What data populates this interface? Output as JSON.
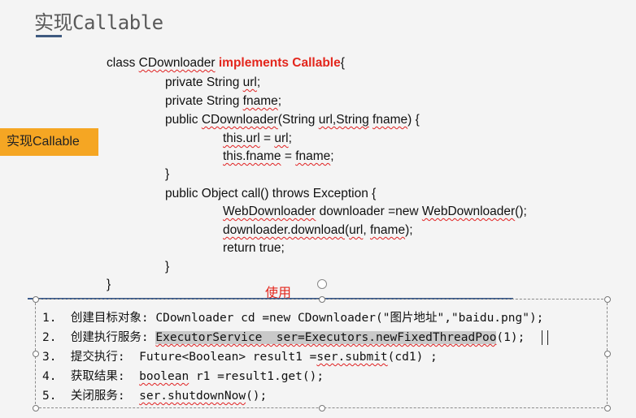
{
  "slide": {
    "title": "实现Callable",
    "tag": "实现Callable",
    "box_label": "使用"
  },
  "code": {
    "l1_a": "class ",
    "l1_b": "CDownloader",
    "l1_c": " implements Callable",
    "l1_d": "{",
    "l2_a": "private String ",
    "l2_b": "url",
    "l2_c": ";",
    "l3_a": "private String ",
    "l3_b": "fname",
    "l3_c": ";",
    "l4_a": "public ",
    "l4_b": "CDownloader",
    "l4_c": "(String ",
    "l4_d": "url,String",
    "l4_e": " ",
    "l4_f": "fname",
    "l4_g": ") {",
    "l5_a": "this.url",
    "l5_b": " = ",
    "l5_c": "url",
    "l5_d": ";",
    "l6_a": "this.fname",
    "l6_b": " = ",
    "l6_c": "fname",
    "l6_d": ";",
    "l7": "}",
    "l8": "public Object call() throws Exception {",
    "l9_a": "WebDownloader",
    "l9_b": " downloader =new ",
    "l9_c": "WebDownloader",
    "l9_d": "();",
    "l10_a": "downloader.download",
    "l10_b": "(",
    "l10_c": "url",
    "l10_d": ", ",
    "l10_e": "fname",
    "l10_f": ");",
    "l11": "return true;",
    "l12": "}",
    "l13": "}"
  },
  "steps": {
    "s1": "1.  创建目标对象: CDownloader cd =new CDownloader(\"图片地址\",\"baidu.png\");",
    "s2_a": "2.  创建执行服务: ",
    "s2_b": "ExecutorService  ser=Executors.newFixedThreadPoo",
    "s2_c": "(1);",
    "s3_a": "3.  提交执行:  Future<Boolean> result1 =",
    "s3_b": "ser.submit",
    "s3_c": "(cd1) ;",
    "s4_a": "4.  获取结果:  ",
    "s4_b": "boolean",
    "s4_c": " r1 =result1.get();",
    "s5_a": "5.  关闭服务:  ",
    "s5_b": "ser.shutdownNow",
    "s5_c": "();"
  },
  "colors": {
    "accent_red": "#e3261c",
    "tag_orange": "#f5a623",
    "rule_blue": "#3b5b8c"
  }
}
